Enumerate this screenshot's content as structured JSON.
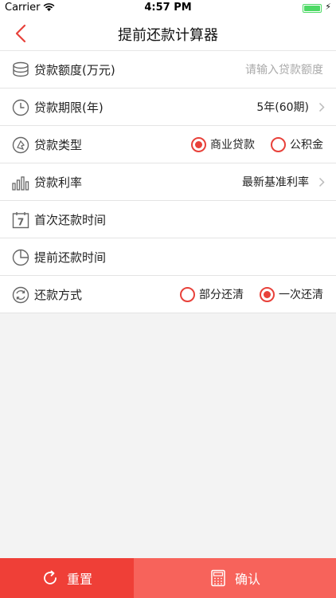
{
  "status": {
    "carrier": "Carrier",
    "time": "4:57 PM"
  },
  "nav": {
    "title": "提前还款计算器"
  },
  "rows": {
    "amount": {
      "label": "贷款额度(万元)",
      "placeholder": "请输入贷款额度"
    },
    "term": {
      "label": "贷款期限(年)",
      "value": "5年(60期)"
    },
    "type": {
      "label": "贷款类型",
      "options": [
        "商业贷款",
        "公积金"
      ],
      "selected": "商业贷款"
    },
    "rate": {
      "label": "贷款利率",
      "value": "最新基准利率"
    },
    "first_time": {
      "label": "首次还款时间"
    },
    "prepay_time": {
      "label": "提前还款时间"
    },
    "method": {
      "label": "还款方式",
      "options": [
        "部分还清",
        "一次还清"
      ],
      "selected": "一次还清"
    }
  },
  "bottom": {
    "reset_label": "重置",
    "confirm_label": "确认"
  },
  "colors": {
    "accent": "#e8413a",
    "reset_bg": "#ef3f37",
    "confirm_bg": "#f7635b"
  }
}
